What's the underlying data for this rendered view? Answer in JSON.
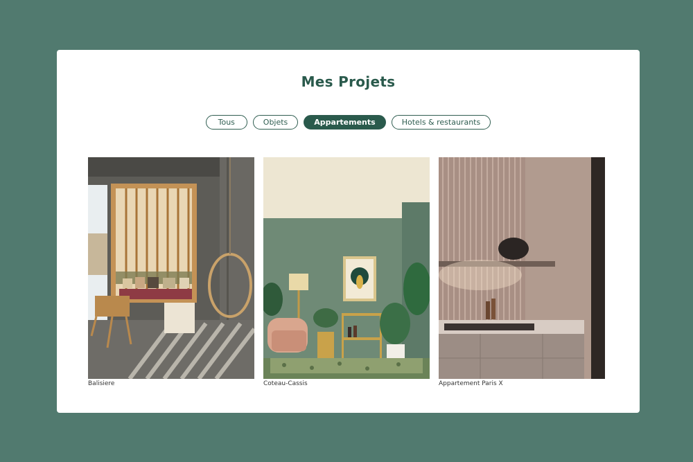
{
  "page": {
    "title": "Mes Projets"
  },
  "filters": [
    {
      "label": "Tous",
      "active": false
    },
    {
      "label": "Objets",
      "active": false
    },
    {
      "label": "Appartements",
      "active": true
    },
    {
      "label": "Hotels & restaurants",
      "active": false
    }
  ],
  "projects": [
    {
      "caption": "Balisiere"
    },
    {
      "caption": "Coteau-Cassis"
    },
    {
      "caption": "Appartement Paris X"
    }
  ],
  "colors": {
    "background": "#517a6f",
    "accent": "#2a5a4c",
    "card": "#ffffff"
  }
}
